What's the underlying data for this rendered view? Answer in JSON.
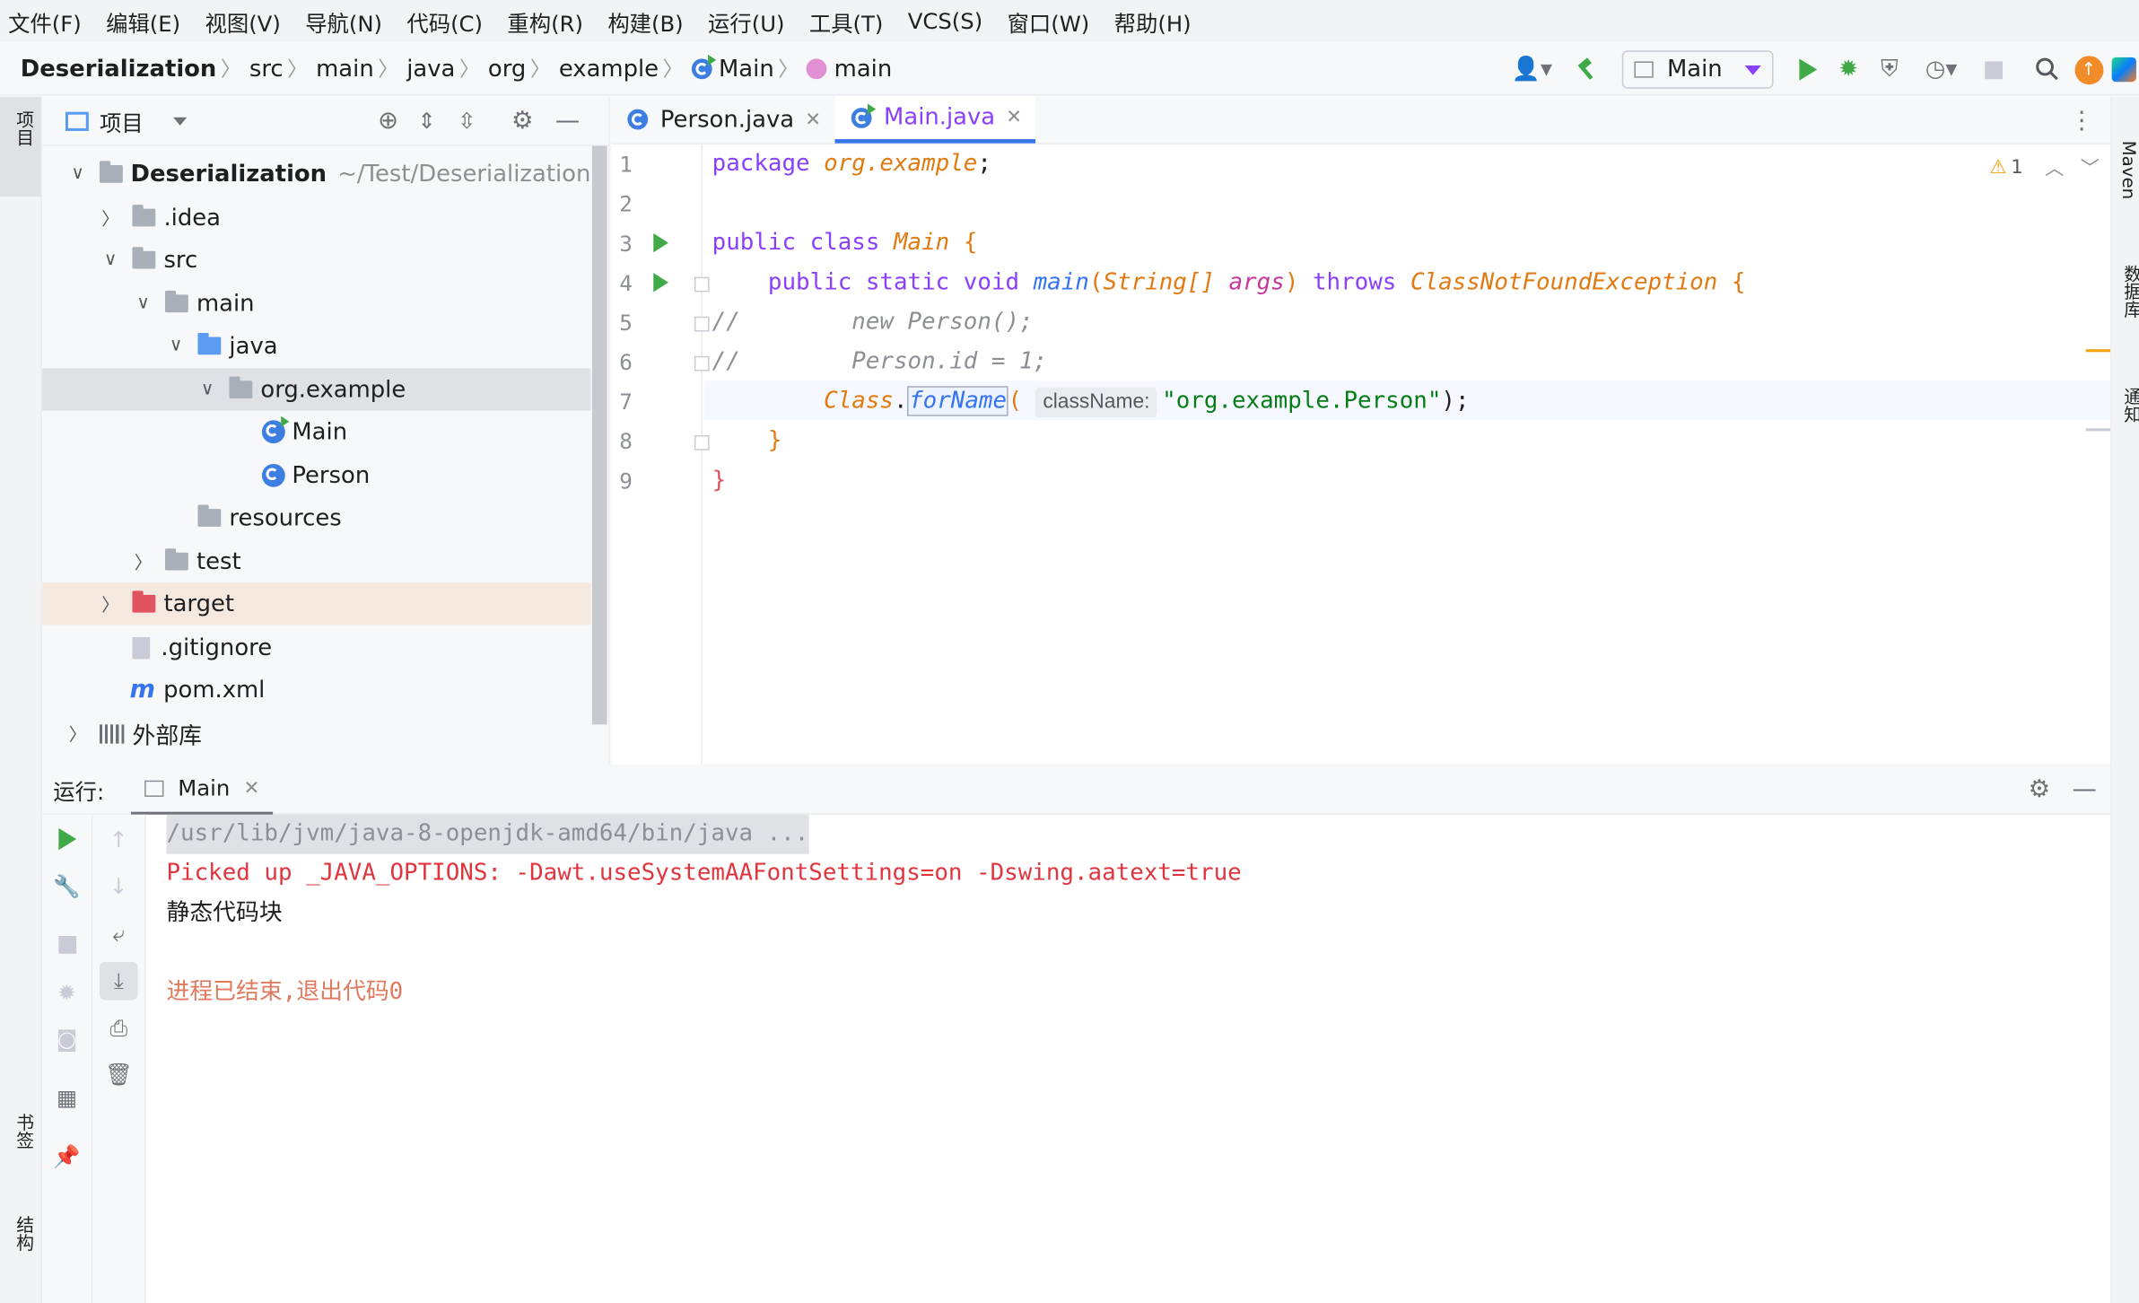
{
  "menu": [
    "文件(F)",
    "编辑(E)",
    "视图(V)",
    "导航(N)",
    "代码(C)",
    "重构(R)",
    "构建(B)",
    "运行(U)",
    "工具(T)",
    "VCS(S)",
    "窗口(W)",
    "帮助(H)"
  ],
  "breadcrumb": {
    "project": "Deserialization",
    "parts": [
      "src",
      "main",
      "java",
      "org",
      "example"
    ],
    "class": "Main",
    "method": "main"
  },
  "toolbar": {
    "run_config": "Main"
  },
  "left_strip": {
    "project": "项目",
    "bookmarks": "书签",
    "structure": "结构"
  },
  "right_strip": {
    "maven": "Maven",
    "database": "数据库",
    "notifications": "通知"
  },
  "project_panel": {
    "title": "项目"
  },
  "tree": [
    {
      "label": "Deserialization",
      "extra": "~/Test/Deserialization"
    },
    {
      "label": ".idea"
    },
    {
      "label": "src"
    },
    {
      "label": "main"
    },
    {
      "label": "java"
    },
    {
      "label": "org.example"
    },
    {
      "label": "Main"
    },
    {
      "label": "Person"
    },
    {
      "label": "resources"
    },
    {
      "label": "test"
    },
    {
      "label": "target"
    },
    {
      "label": ".gitignore"
    },
    {
      "label": "pom.xml"
    },
    {
      "label": "外部库"
    }
  ],
  "tabs": [
    {
      "label": "Person.java"
    },
    {
      "label": "Main.java"
    }
  ],
  "editor": {
    "warning_count": "1",
    "line_numbers": [
      "1",
      "2",
      "3",
      "4",
      "5",
      "6",
      "7",
      "8",
      "9"
    ],
    "lines": {
      "l1": {
        "kw": "package",
        "pkg": "org.example",
        ";": ";"
      },
      "l3": {
        "a": "public class",
        "b": "Main",
        "c": "{"
      },
      "l4": {
        "a": "public static void",
        "b": "main",
        "c": "(",
        "d": "String[]",
        "e": "args",
        ")": ")",
        "f": "throws",
        "g": "ClassNotFoundException",
        "h": "{"
      },
      "l5": "//        new Person();",
      "l6": "//        Person.id = 1;",
      "l7": {
        "a": "Class",
        "dot": ".",
        "b": "forName",
        "c": "(",
        "hint": "className:",
        "d": "\"org.example.Person\"",
        "e": ");"
      },
      "l8": "}",
      "l9": "}"
    }
  },
  "run": {
    "label": "运行:",
    "tab": "Main",
    "output": [
      "/usr/lib/jvm/java-8-openjdk-amd64/bin/java ...",
      "Picked up _JAVA_OPTIONS: -Dawt.useSystemAAFontSettings=on -Dswing.aatext=true",
      "静态代码块",
      "",
      "进程已结束,退出代码0"
    ]
  },
  "colors": {
    "accent": "#3574f0",
    "run_green": "#3faa47",
    "error_red": "#e0525f"
  }
}
